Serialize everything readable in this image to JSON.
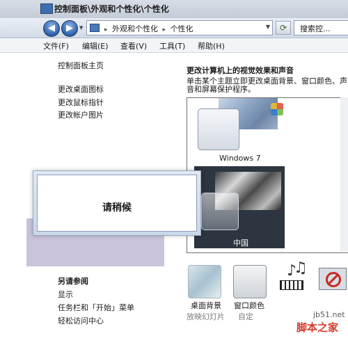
{
  "window": {
    "title": "控制面板\\外观和个性化\\个性化"
  },
  "address": {
    "crumbs": [
      "外观和个性化",
      "个性化"
    ],
    "search_placeholder": "搜索控..."
  },
  "menu": [
    "文件(F)",
    "编辑(E)",
    "查看(V)",
    "工具(T)",
    "帮助(H)"
  ],
  "sidebar": {
    "home": "控制面板主页",
    "links": [
      "更改桌面图标",
      "更改鼠标指针",
      "更改帐户图片"
    ],
    "see_also_title": "另请参阅",
    "see_also": [
      "显示",
      "任务栏和「开始」菜单",
      "轻松访问中心"
    ]
  },
  "main": {
    "heading": "更改计算机上的视觉效果和声音",
    "description": "单击某个主题立即更改桌面背景、窗口颜色、声音和屏幕保护程序。",
    "themes": [
      {
        "label": "Windows 7",
        "selected": false
      },
      {
        "label": "中国",
        "selected": true
      }
    ],
    "bottom_items": [
      {
        "label": "桌面背景",
        "sub": "放映幻灯片"
      },
      {
        "label": "窗口颜色",
        "sub": "自定"
      }
    ]
  },
  "dialog": {
    "message": "请稍候"
  },
  "watermark": {
    "site": "jb51.net",
    "brand": "脚本之家"
  }
}
